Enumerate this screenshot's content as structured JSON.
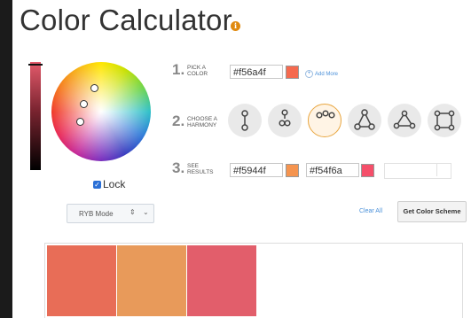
{
  "title": "Color Calculator",
  "info_icon": "info-icon",
  "picker": {
    "lock_label": "Lock",
    "lock_checked": true,
    "mode": "RYB Mode",
    "handles": [
      "handle-1",
      "handle-2",
      "handle-3"
    ]
  },
  "steps": [
    {
      "num": "1.",
      "line1": "PICK A",
      "line2": "COLOR"
    },
    {
      "num": "2.",
      "line1": "CHOOSE A",
      "line2": "HARMONY"
    },
    {
      "num": "3.",
      "line1": "SEE",
      "line2": "RESULTS"
    }
  ],
  "pick": {
    "hex": "#f56a4f",
    "color": "#f56a4f",
    "add_more": "Add More"
  },
  "harmonies": [
    "complementary-icon",
    "split-complementary-icon",
    "analogous-icon",
    "triadic-icon",
    "triangle-icon",
    "square-icon"
  ],
  "selected_harmony": "analogous-icon",
  "results": [
    {
      "hex": "#f5944f",
      "color": "#f5944f"
    },
    {
      "hex": "#f54f6a",
      "color": "#f54f6a"
    }
  ],
  "actions": {
    "clear": "Clear All",
    "get_scheme": "Get Color Scheme"
  },
  "palette": [
    "#e86d57",
    "#e89a5a",
    "#e25e6b"
  ]
}
